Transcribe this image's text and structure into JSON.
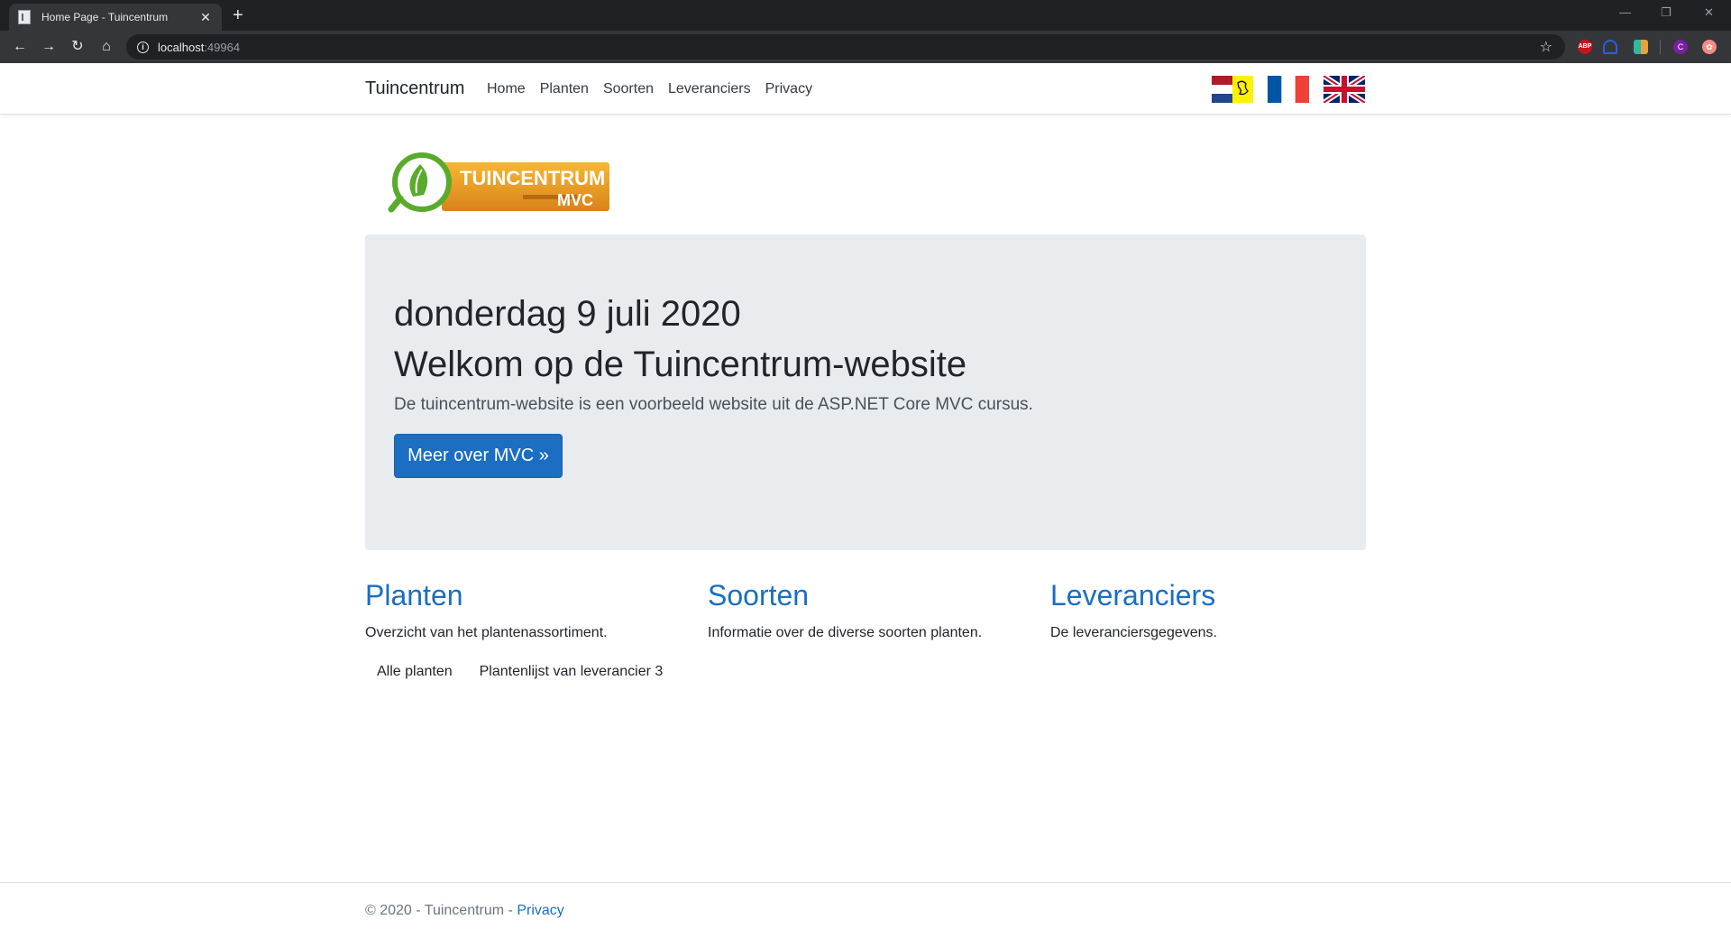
{
  "browser": {
    "tab_title": "Home Page - Tuincentrum",
    "tab_close": "✕",
    "new_tab": "+",
    "url_host": "localhost",
    "url_port": ":49964",
    "ext_abp": "ABP",
    "ext_avatar": "C",
    "ext_5": "✿"
  },
  "navbar": {
    "brand": "Tuincentrum",
    "links": [
      "Home",
      "Planten",
      "Soorten",
      "Leveranciers",
      "Privacy"
    ]
  },
  "logo": {
    "line1": "TUINCENTRUM",
    "line2": "MVC"
  },
  "jumbotron": {
    "date": "donderdag 9 juli 2020",
    "title": "Welkom op de Tuincentrum-website",
    "lead": "De tuincentrum-website is een voorbeeld website uit de ASP.NET Core MVC cursus.",
    "button": "Meer over MVC »"
  },
  "columns": [
    {
      "title": "Planten",
      "text": "Overzicht van het plantenassortiment."
    },
    {
      "title": "Soorten",
      "text": "Informatie over de diverse soorten planten."
    },
    {
      "title": "Leveranciers",
      "text": "De leveranciersgegevens."
    }
  ],
  "sublinks": [
    "Alle planten",
    "Plantenlijst van leverancier 3"
  ],
  "footer": {
    "text": "© 2020 - Tuincentrum - ",
    "link": "Privacy"
  },
  "colors": {
    "primary": "#1b6ec2",
    "jumbotron_bg": "#e9ecef"
  }
}
